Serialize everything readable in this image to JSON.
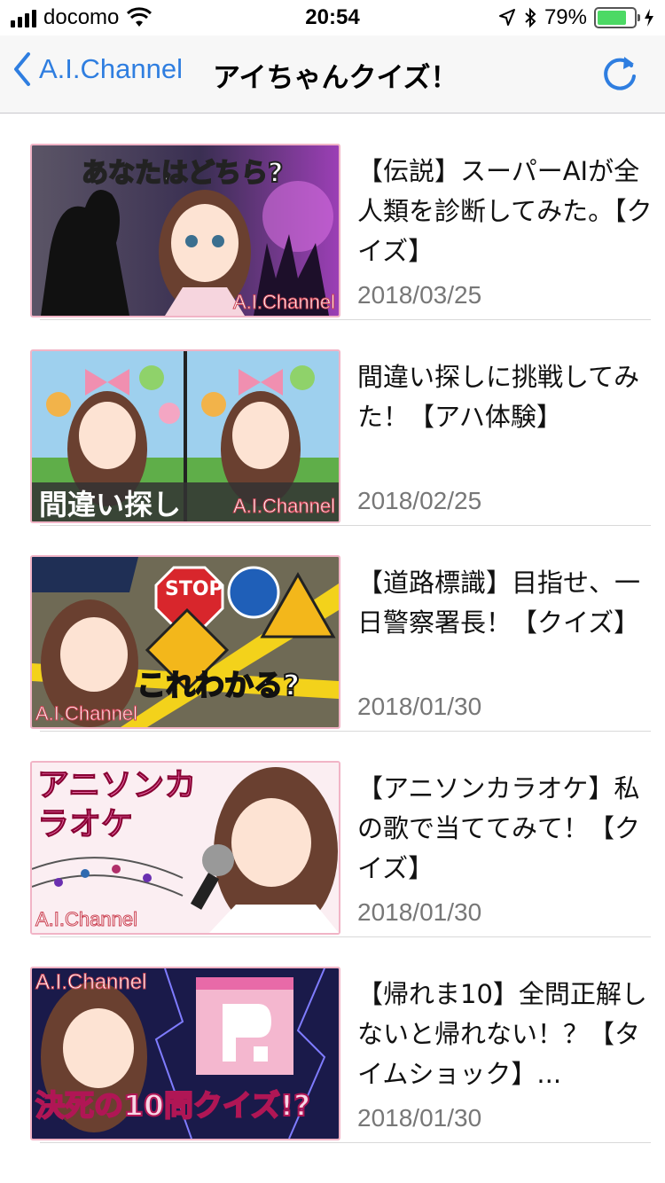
{
  "status_bar": {
    "carrier": "docomo",
    "time": "20:54",
    "battery_percent": "79%",
    "battery_level": 0.79,
    "icons": [
      "signal-icon",
      "wifi-icon",
      "location-arrow-icon",
      "bluetooth-icon",
      "battery-icon",
      "charging-bolt-icon"
    ]
  },
  "nav": {
    "back_label": "A.I.Channel",
    "title": "アイちゃんクイズ！",
    "back_icon": "chevron-left-icon",
    "refresh_icon": "refresh-icon"
  },
  "colors": {
    "accent": "#2f7ee0",
    "thumbnail_border": "#f1b4c6",
    "separator": "#d9d9d9",
    "date_text": "#777777"
  },
  "videos": [
    {
      "title": "【伝説】スーパーAIが全人類を診断してみた。【クイズ】",
      "date": "2018/03/25",
      "thumbnail_text": "あなたはどちら?",
      "thumbnail_watermark": "A.I.Channel"
    },
    {
      "title": "間違い探しに挑戦してみた！【アハ体験】",
      "date": "2018/02/25",
      "thumbnail_text": "間違い探し",
      "thumbnail_watermark": "A.I.Channel"
    },
    {
      "title": "【道路標識】目指せ、一日警察署長！【クイズ】",
      "date": "2018/01/30",
      "thumbnail_text": "これわかる?",
      "thumbnail_watermark": "A.I.Channel"
    },
    {
      "title": "【アニソンカラオケ】私の歌で当ててみて！【クイズ】",
      "date": "2018/01/30",
      "thumbnail_text": "アニソンカラオケ",
      "thumbnail_watermark": "A.I.Channel"
    },
    {
      "title": "【帰れま10】全問正解しないと帰れない！？【タイムショック】...",
      "date": "2018/01/30",
      "thumbnail_text": "決死の10問クイズ!?",
      "thumbnail_watermark": "A.I.Channel"
    }
  ]
}
